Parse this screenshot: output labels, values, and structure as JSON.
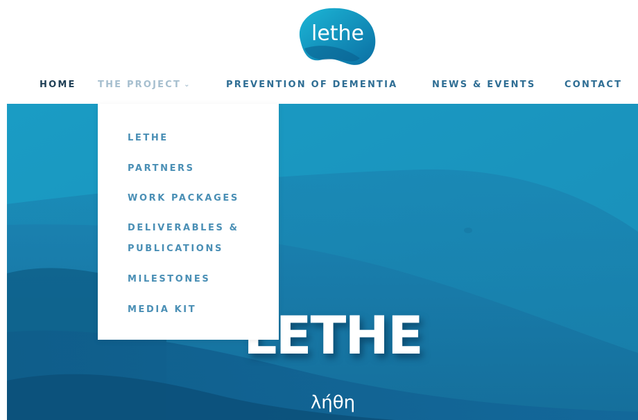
{
  "logo": {
    "text": "lethe"
  },
  "nav": {
    "items": [
      {
        "label": "HOME"
      },
      {
        "label": "THE PROJECT"
      },
      {
        "label": "PREVENTION OF DEMENTIA"
      },
      {
        "label": "NEWS & EVENTS"
      },
      {
        "label": "CONTACT"
      }
    ],
    "project_chevron": "⌄"
  },
  "dropdown": {
    "items": [
      {
        "label": "LETHE"
      },
      {
        "label": "PARTNERS"
      },
      {
        "label": "WORK PACKAGES"
      },
      {
        "label_line1": "DELIVERABLES &",
        "label_line2": "PUBLICATIONS"
      },
      {
        "label": "MILESTONES"
      },
      {
        "label": "MEDIA KIT"
      }
    ]
  },
  "hero": {
    "title": "LETHE",
    "subtitle": "λήθη"
  },
  "colors": {
    "brand_blue": "#1a93bd",
    "nav_text": "#2f6e94",
    "nav_active": "#1f3f55",
    "nav_hover": "#a6bfcf",
    "dropdown_text": "#4a8fb5"
  }
}
